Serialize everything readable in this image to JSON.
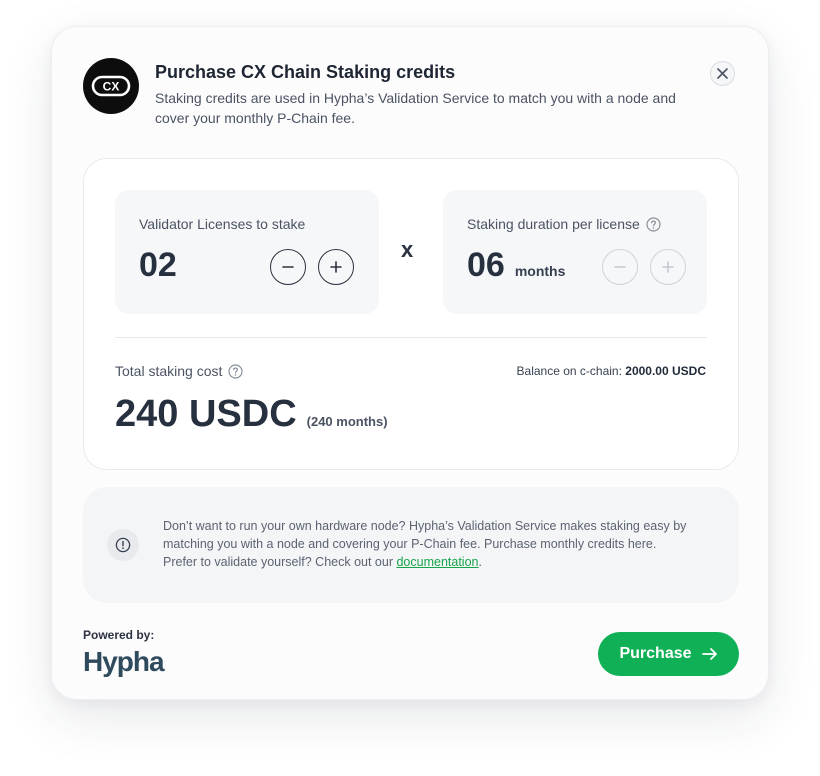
{
  "header": {
    "logo_text": "CX",
    "title": "Purchase CX Chain Staking credits",
    "subtitle": "Staking credits are used in Hypha’s Validation Service to match you with a node and cover your monthly P-Chain fee."
  },
  "licenses": {
    "label": "Validator Licenses to stake",
    "value": "02"
  },
  "multiply_sign": "x",
  "duration": {
    "label": "Staking duration per license",
    "value": "06",
    "unit": "months"
  },
  "total": {
    "label": "Total staking cost",
    "amount": "240 USDC",
    "months": "(240 months)"
  },
  "balance": {
    "label": "Balance on c-chain:",
    "value": "2000.00 USDC"
  },
  "info": {
    "text": "Don’t want to run your own hardware node? Hypha’s Validation Service makes staking easy by matching you with a node and covering your P-Chain fee. Purchase monthly credits here. Prefer to validate yourself? Check out our ",
    "link_text": "documentation",
    "suffix": "."
  },
  "footer": {
    "powered_by": "Powered by:",
    "brand": "Hypha",
    "purchase_label": "Purchase"
  },
  "colors": {
    "accent": "#10b156",
    "link": "#16a34a",
    "text_dark": "#27303f"
  },
  "icons": {
    "close": "close-icon",
    "minus": "minus-icon",
    "plus": "plus-icon",
    "help": "help-circle-icon",
    "info": "info-circle-icon",
    "arrow": "arrow-right-icon"
  }
}
